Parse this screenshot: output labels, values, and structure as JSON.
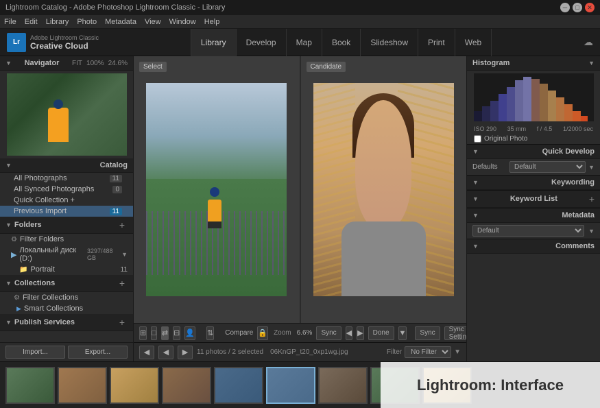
{
  "titleBar": {
    "title": "Lightroom Catalog - Adobe Photoshop Lightroom Classic - Library"
  },
  "menuBar": {
    "items": [
      "File",
      "Edit",
      "Library",
      "Photo",
      "Metadata",
      "View",
      "Window",
      "Help"
    ]
  },
  "header": {
    "logoSmall": "Adobe Lightroom Classic",
    "logoLarge": "Creative Cloud",
    "navTabs": [
      {
        "label": "Library",
        "active": true
      },
      {
        "label": "Develop",
        "active": false
      },
      {
        "label": "Map",
        "active": false
      },
      {
        "label": "Book",
        "active": false
      },
      {
        "label": "Slideshow",
        "active": false
      },
      {
        "label": "Print",
        "active": false
      },
      {
        "label": "Web",
        "active": false
      }
    ]
  },
  "leftPanel": {
    "navigator": {
      "title": "Navigator",
      "controls": [
        "FIT",
        "100%",
        "24.6%"
      ]
    },
    "catalog": {
      "title": "Catalog",
      "items": [
        {
          "label": "All Photographs",
          "count": "11"
        },
        {
          "label": "All Synced Photographs",
          "count": "0"
        },
        {
          "label": "Quick Collection +",
          "count": ""
        },
        {
          "label": "Previous Import",
          "count": "11",
          "selected": true
        }
      ]
    },
    "folders": {
      "title": "Folders",
      "items": [
        {
          "label": "Filter Folders"
        },
        {
          "label": "Локальный диск (D:)",
          "size": "3297/488 GB",
          "isRoot": true
        },
        {
          "label": "Portrait",
          "count": "11"
        }
      ]
    },
    "collections": {
      "title": "Collections",
      "items": [
        {
          "label": "Filter Collections"
        },
        {
          "label": "Smart Collections",
          "isGroup": true
        }
      ]
    },
    "publishServices": {
      "title": "Publish Services"
    },
    "importBtn": "Import...",
    "exportBtn": "Export..."
  },
  "compareView": {
    "selectLabel": "Select",
    "candidateLabel": "Candidate"
  },
  "bottomToolbar": {
    "compareLabel": "Compare",
    "zoomLabel": "6.6%",
    "syncLabel": "Sync",
    "doneLabel": "Done",
    "syncRightLabel": "Sync",
    "syncSettingsLabel": "Sync Settings"
  },
  "filmstrip": {
    "info": "11 photos / 2 selected",
    "path": "06KnGP_t20_0xp1wg.jpg",
    "filterLabel": "Filter",
    "filterValue": "No Filter"
  },
  "rightPanel": {
    "histogram": {
      "title": "Histogram",
      "info": [
        "ISO 290",
        "35 mm",
        "f / 4.5",
        "1/2000 sec"
      ],
      "originalPhoto": "Original Photo"
    },
    "quickDevelop": {
      "title": "Quick Develop",
      "presetLabel": "Defaults",
      "presetValue": "Default"
    },
    "keywording": {
      "title": "Keywording"
    },
    "keywordList": {
      "title": "Keyword List"
    },
    "metadata": {
      "title": "Metadata",
      "presetValue": "Default"
    },
    "comments": {
      "title": "Comments"
    }
  },
  "watermark": "Lightroom: Interface"
}
